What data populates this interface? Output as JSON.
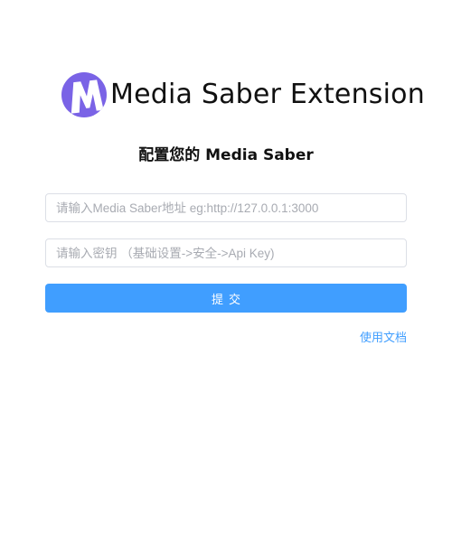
{
  "brand": {
    "logo_icon": "media-saber-m-logo",
    "logo_letter": "M",
    "title": "Media Saber Extension",
    "colors": {
      "logo_bg": "#7a63e6",
      "logo_letter": "#ffffff"
    }
  },
  "header": {
    "subtitle": "配置您的 Media Saber"
  },
  "form": {
    "url_field": {
      "value": "",
      "placeholder": "请输入Media Saber地址 eg:http://127.0.0.1:3000"
    },
    "key_field": {
      "value": "",
      "placeholder": "请输入密钥 （基础设置->安全->Api Key)"
    },
    "submit_label": "提交",
    "colors": {
      "primary": "#409eff",
      "border": "#dcdfe6",
      "placeholder": "#a8abb2"
    }
  },
  "footer": {
    "docs_link_label": "使用文档"
  }
}
